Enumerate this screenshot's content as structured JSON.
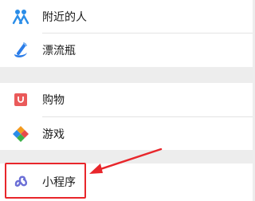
{
  "menu": {
    "group1": [
      {
        "label": "附近的人",
        "icon": "people-nearby-icon"
      },
      {
        "label": "漂流瓶",
        "icon": "drift-bottle-icon"
      }
    ],
    "group2": [
      {
        "label": "购物",
        "icon": "shopping-icon"
      },
      {
        "label": "游戏",
        "icon": "games-icon"
      }
    ],
    "group3": [
      {
        "label": "小程序",
        "icon": "mini-program-icon"
      }
    ]
  },
  "colors": {
    "background": "#ededed",
    "row_bg": "#ffffff",
    "annotation_red": "#e8262b",
    "people_blue": "#2a8de8",
    "bottle_blue": "#2b7de9",
    "shopping_red": "#ea5a5a",
    "miniprogram_purple": "#6b6fd6"
  }
}
